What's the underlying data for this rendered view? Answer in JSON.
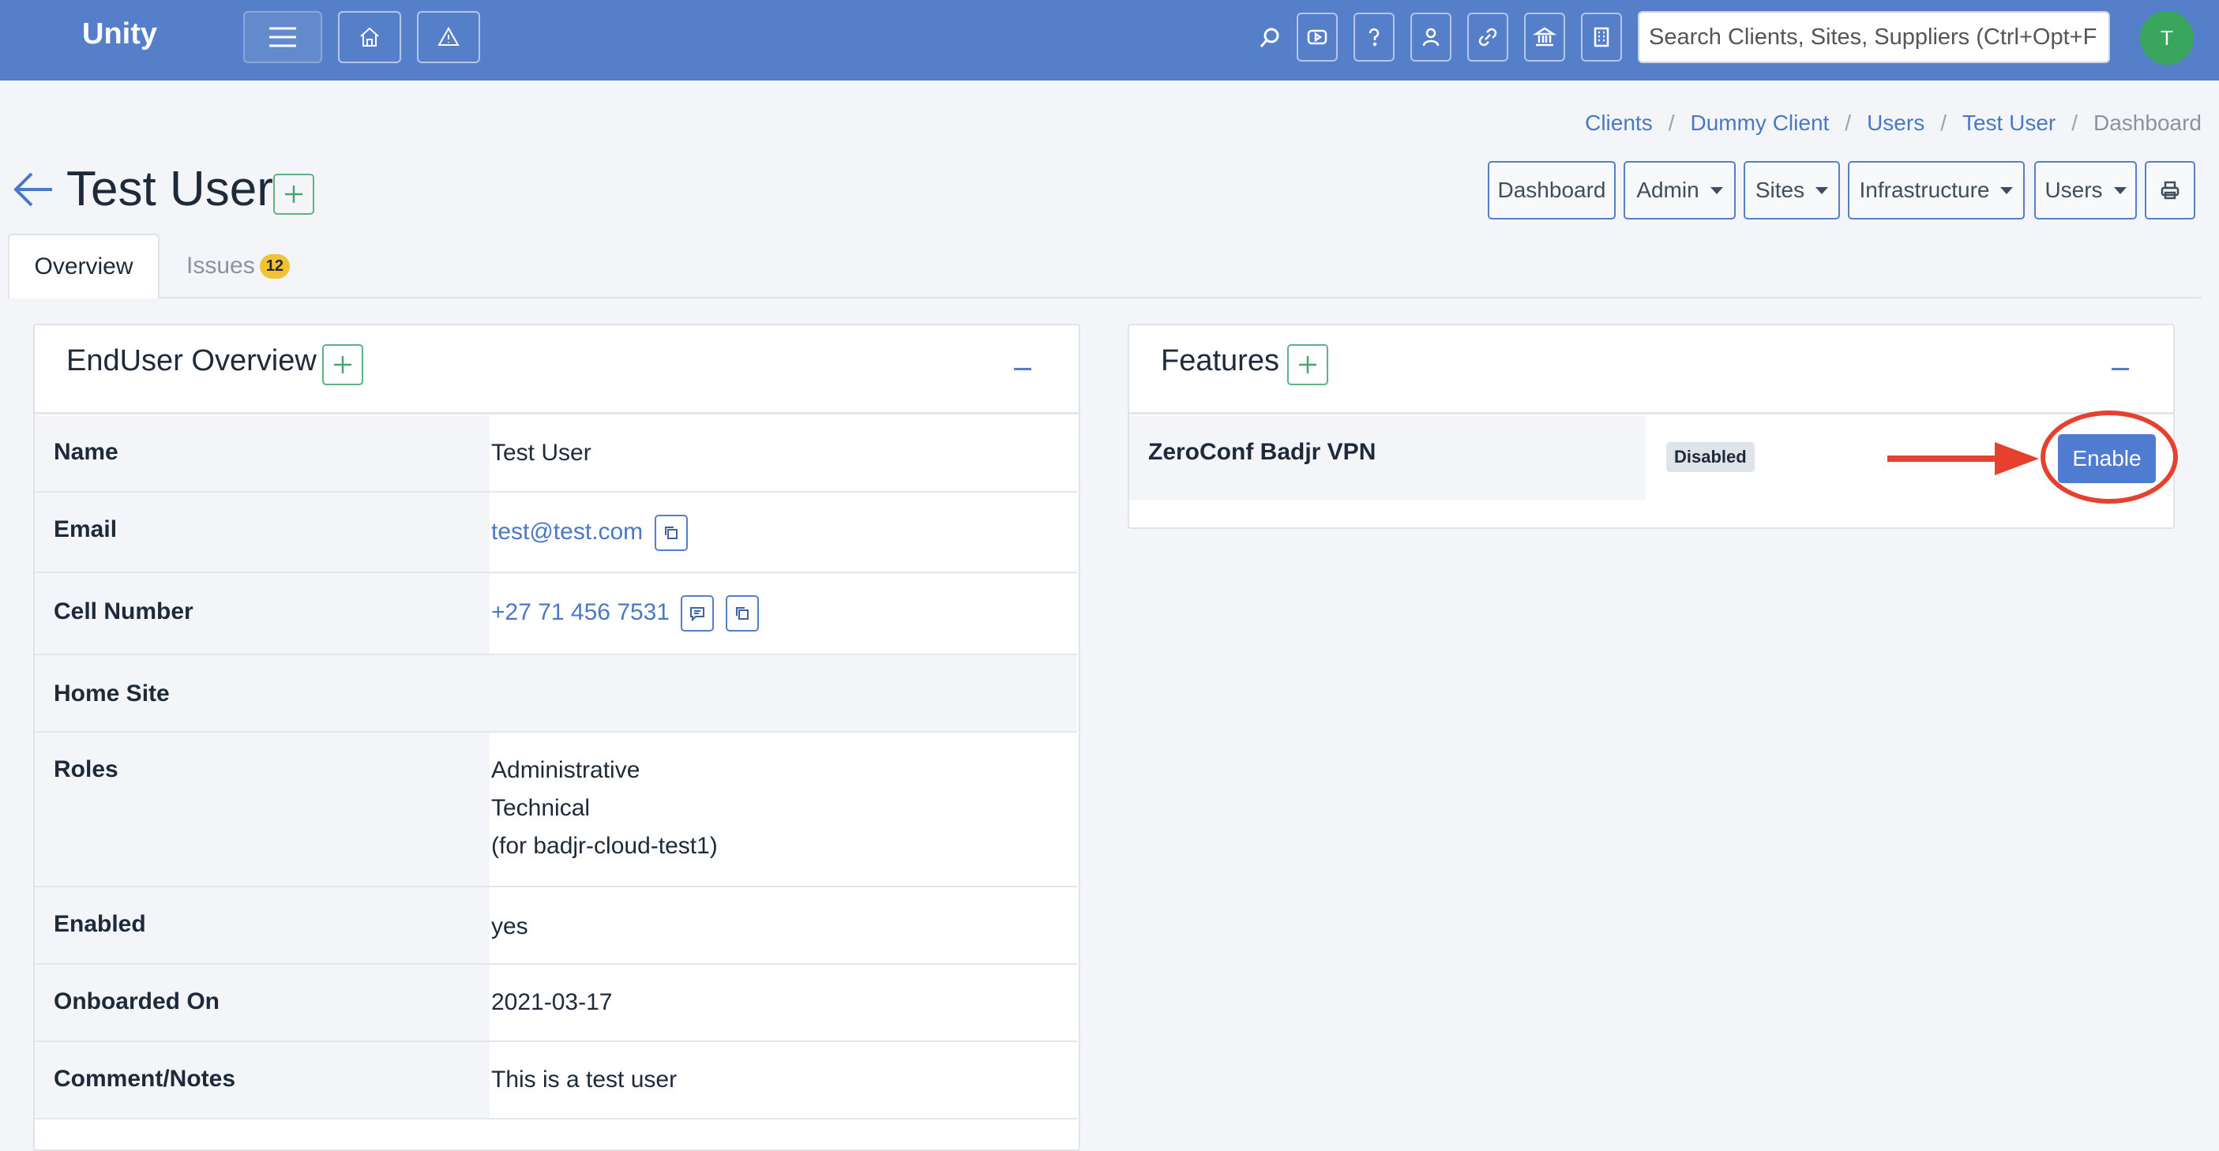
{
  "navbar": {
    "brand": "Unity",
    "search_placeholder": "Search Clients, Sites, Suppliers (Ctrl+Opt+F",
    "avatar_initial": "T",
    "bg_color": "#5580c9"
  },
  "breadcrumb": {
    "items": [
      "Clients",
      "Dummy Client",
      "Users",
      "Test User"
    ],
    "current": "Dashboard",
    "separator": "/"
  },
  "page": {
    "title": "Test User"
  },
  "toolbar": {
    "dashboard": "Dashboard",
    "admin": "Admin",
    "sites": "Sites",
    "infrastructure": "Infrastructure",
    "users": "Users"
  },
  "tabs": {
    "overview": "Overview",
    "issues": "Issues",
    "issues_count": "12"
  },
  "enduser": {
    "title": "EndUser Overview",
    "rows": [
      {
        "label": "Name",
        "value": "Test User"
      },
      {
        "label": "Email",
        "value": "test@test.com"
      },
      {
        "label": "Cell Number",
        "value": "+27 71 456 7531"
      },
      {
        "label": "Home Site",
        "value": ""
      },
      {
        "label": "Roles",
        "lines": [
          "Administrative",
          "Technical",
          "(for badjr-cloud-test1)"
        ]
      },
      {
        "label": "Enabled",
        "value": "yes"
      },
      {
        "label": "Onboarded On",
        "value": "2021-03-17"
      },
      {
        "label": "Comment/Notes",
        "value": "This is a test user"
      }
    ]
  },
  "features": {
    "title": "Features",
    "items": [
      {
        "name": "ZeroConf Badjr VPN",
        "status": "Disabled",
        "action": "Enable"
      }
    ]
  },
  "annotation_color": "#e5412e"
}
